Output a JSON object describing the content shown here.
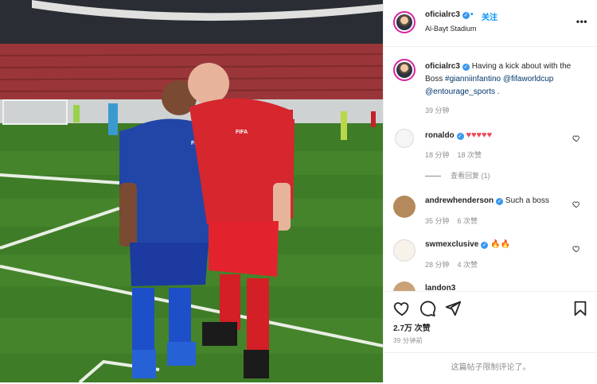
{
  "post": {
    "author": "oficialrc3",
    "follow_label": "关注",
    "location": "Al-Bayt Stadium",
    "more_icon": "more-horizontal-icon"
  },
  "caption": {
    "author": "oficialrc3",
    "text_prefix": "Having a kick about with the Boss ",
    "hashtag": "#gianniinfantino",
    "mention1": "@fifaworldcup",
    "mention2": "@entourage_sports",
    "suffix": " .",
    "time": "39 分钟"
  },
  "comments": [
    {
      "author": "ronaldo",
      "text": "♥♥♥♥♥",
      "time": "18 分钟",
      "likes": "18 次赞",
      "replies": "查看回复 (1)"
    },
    {
      "author": "andrewhenderson",
      "text": "Such a boss",
      "time": "35 分钟",
      "likes": "6 次赞"
    },
    {
      "author": "swmexclusive",
      "text": "🔥🔥",
      "time": "28 分钟",
      "likes": "4 次赞"
    },
    {
      "author": "landon3"
    }
  ],
  "actions": {
    "like_icon": "heart-icon",
    "comment_icon": "comment-icon",
    "share_icon": "share-icon",
    "save_icon": "bookmark-icon",
    "likes": "2.7万 次赞",
    "posted_ago": "39 分钟前",
    "comments_restricted": "这篇帖子限制评论了。"
  },
  "photo": {
    "jersey_text_1": "FIFA",
    "jersey_text_2": "FIFA"
  },
  "colors": {
    "accent_blue": "#0095f6",
    "verified": "#3897f0",
    "heart_red": "#ed4956",
    "muted": "#8e8e8e"
  }
}
